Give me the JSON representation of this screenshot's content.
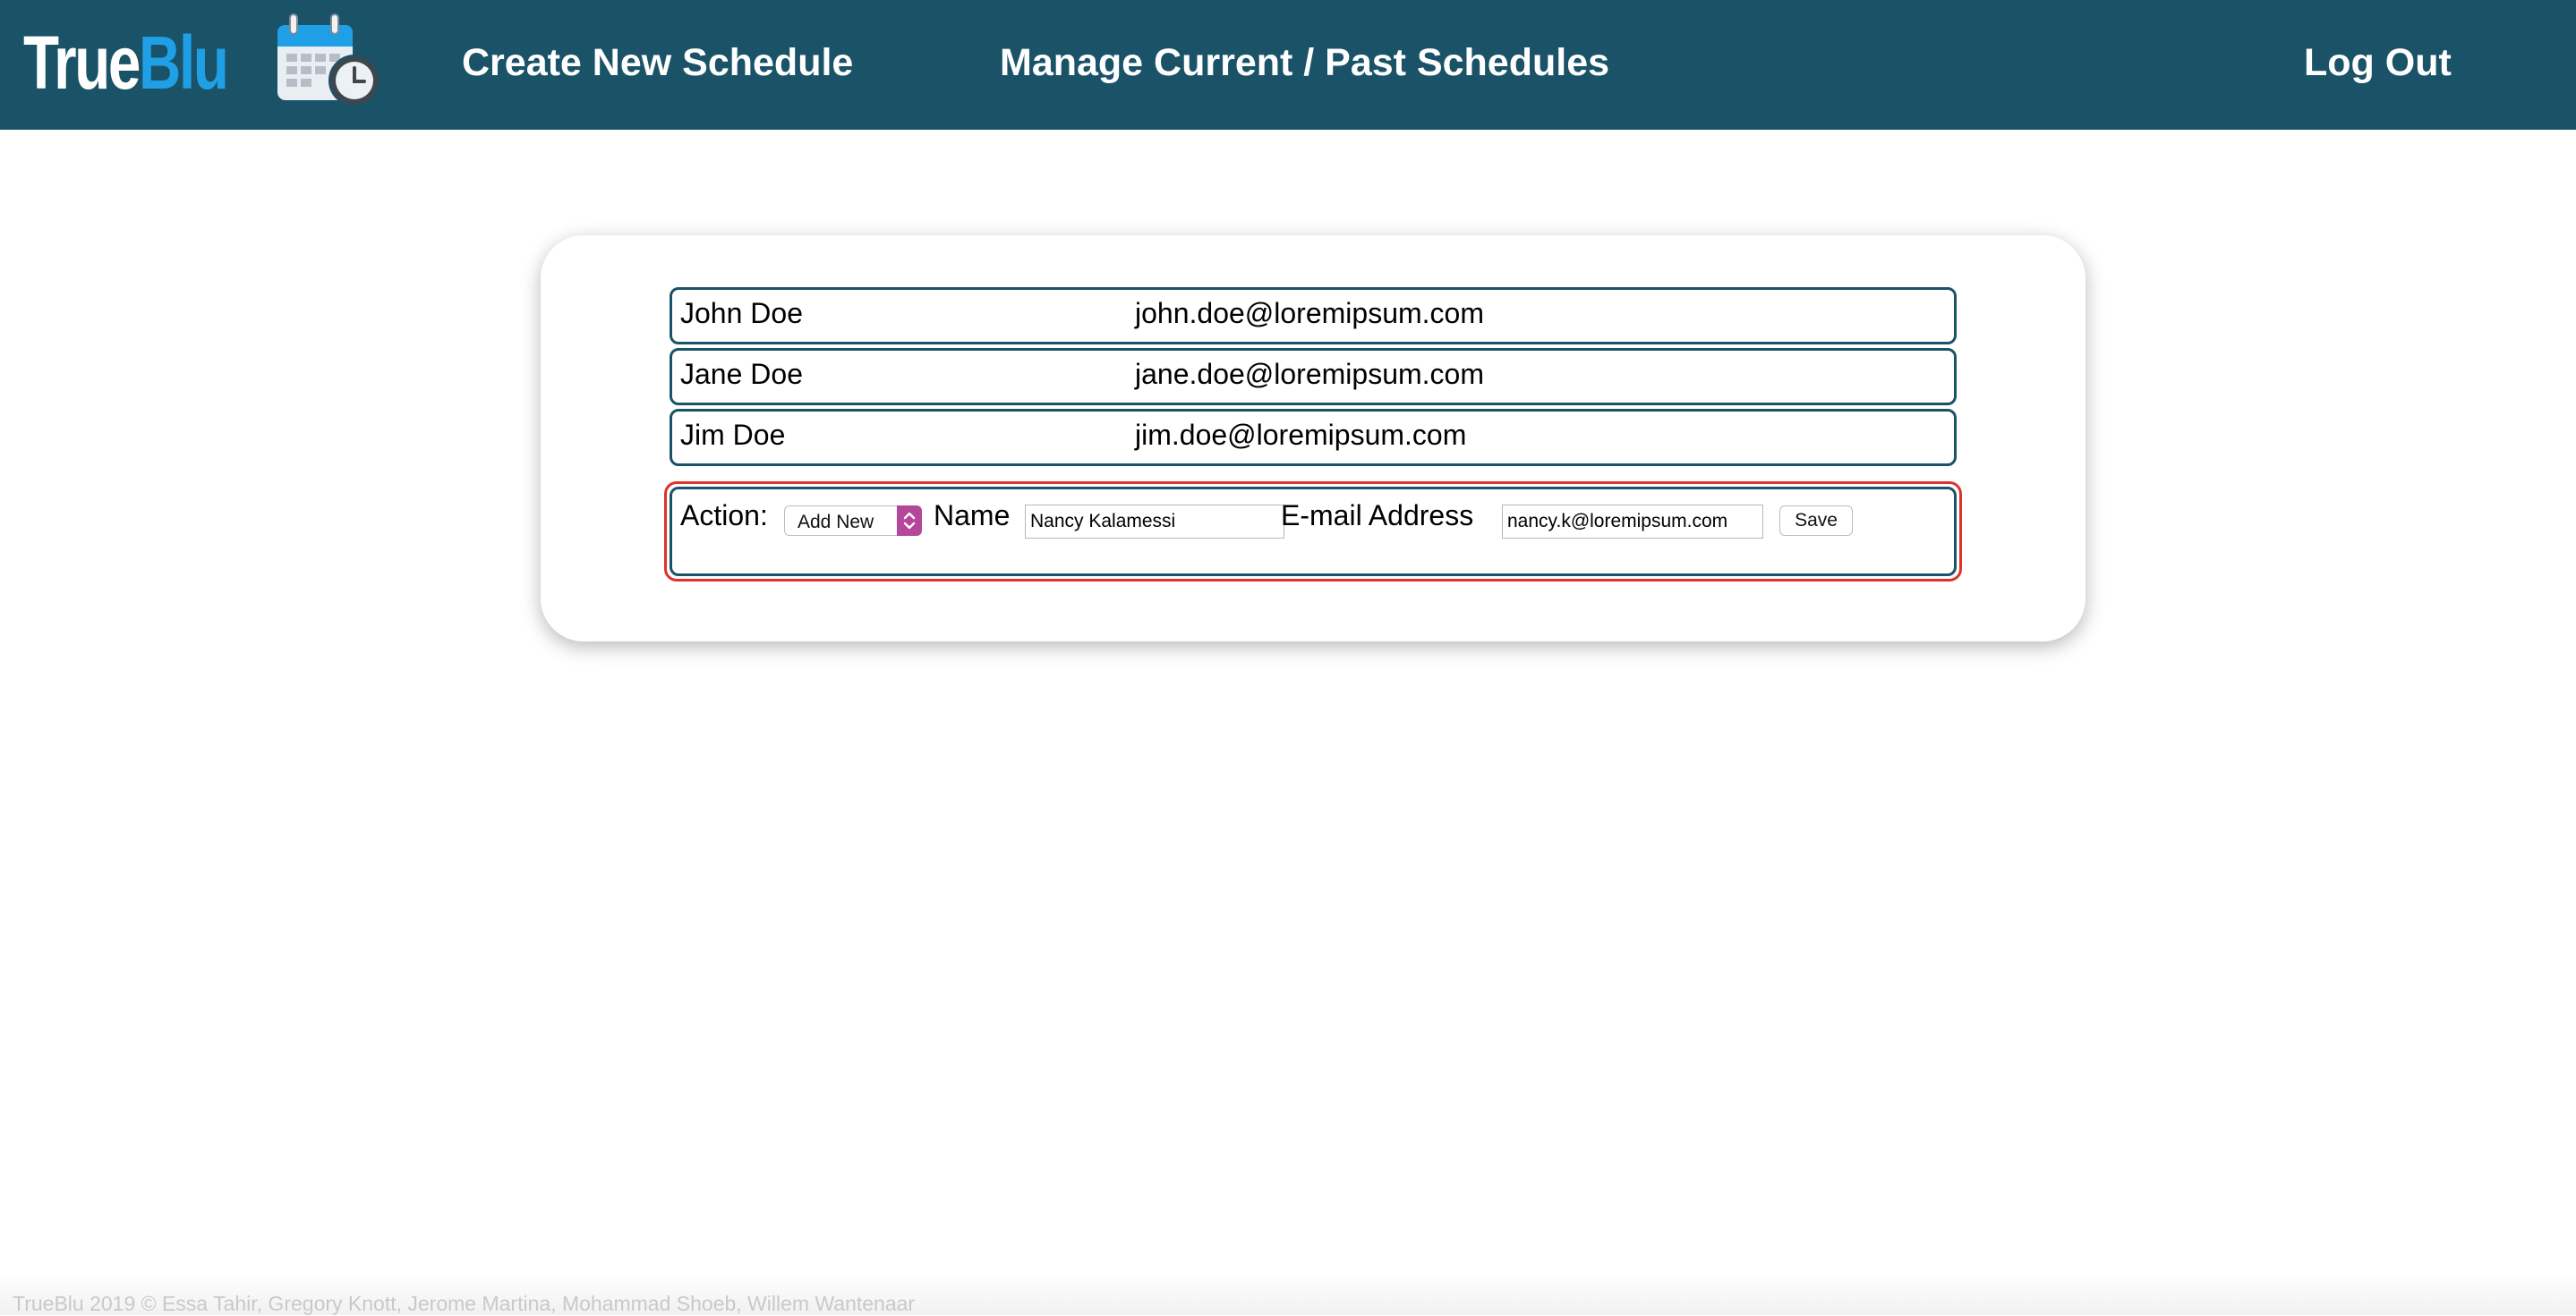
{
  "header": {
    "logo_part1": "True",
    "logo_part2": "Blu",
    "nav": {
      "create": "Create New Schedule",
      "manage": "Manage Current / Past Schedules",
      "logout": "Log Out"
    }
  },
  "people": [
    {
      "name": "John Doe",
      "email": "john.doe@loremipsum.com"
    },
    {
      "name": "Jane Doe",
      "email": "jane.doe@loremipsum.com"
    },
    {
      "name": "Jim Doe",
      "email": "jim.doe@loremipsum.com"
    }
  ],
  "form": {
    "action_label": "Action:",
    "action_value": "Add New",
    "name_label": "Name",
    "name_value": "Nancy Kalamessi",
    "email_label": "E-mail Address",
    "email_value": "nancy.k@loremipsum.com",
    "save_label": "Save"
  },
  "footer": {
    "text": "TrueBlu 2019 © Essa Tahir, Gregory Knott, Jerome Martina, Mohammad Shoeb, Willem Wantenaar"
  },
  "colors": {
    "header_bg": "#1a5368",
    "logo_blue": "#1fa0e6",
    "row_border": "#1a5368",
    "highlight_border": "#e0312b",
    "select_accent": "#b4479a"
  },
  "icons": {
    "logo": "calendar-clock-icon",
    "select": "chevron-up-down-icon"
  }
}
